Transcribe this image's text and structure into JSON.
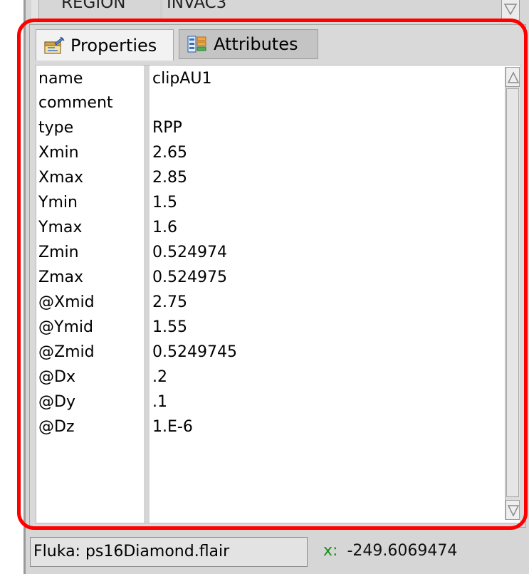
{
  "top_row": {
    "key": "REGION",
    "value": "INVAC3"
  },
  "tabs": [
    {
      "label": "Properties",
      "icon": "properties-icon",
      "active": true
    },
    {
      "label": "Attributes",
      "icon": "attributes-icon",
      "active": false
    }
  ],
  "properties": [
    {
      "key": "name",
      "value": "clipAU1"
    },
    {
      "key": "comment",
      "value": ""
    },
    {
      "key": "type",
      "value": "RPP"
    },
    {
      "key": "Xmin",
      "value": "2.65"
    },
    {
      "key": "Xmax",
      "value": "2.85"
    },
    {
      "key": "Ymin",
      "value": "1.5"
    },
    {
      "key": "Ymax",
      "value": "1.6"
    },
    {
      "key": "Zmin",
      "value": "0.524974"
    },
    {
      "key": "Zmax",
      "value": "0.524975"
    },
    {
      "key": "@Xmid",
      "value": "2.75"
    },
    {
      "key": "@Ymid",
      "value": "1.55"
    },
    {
      "key": "@Zmid",
      "value": "0.5249745"
    },
    {
      "key": "@Dx",
      "value": ".2"
    },
    {
      "key": "@Dy",
      "value": ".1"
    },
    {
      "key": "@Dz",
      "value": "1.E-6"
    }
  ],
  "status": {
    "file": "Fluka: ps16Diamond.flair",
    "coord_label": "x:",
    "coord_value": "-249.6069474"
  },
  "colors": {
    "highlight": "#ff0000",
    "coord_label": "#1c8c1c"
  }
}
